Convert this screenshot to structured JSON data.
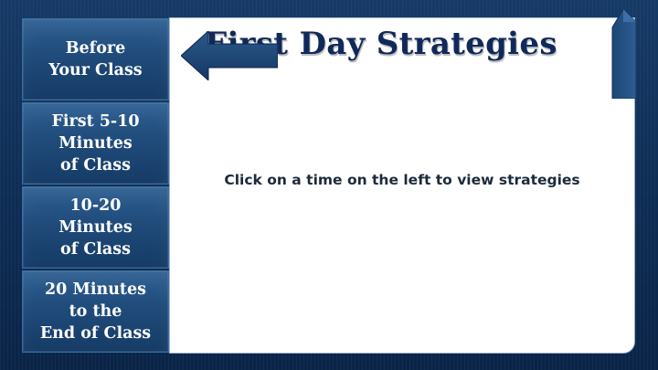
{
  "header": {
    "title": "First Day Strategies"
  },
  "sidebar": {
    "items": [
      {
        "label": "Before\nYour Class"
      },
      {
        "label": "First 5-10\nMinutes\nof Class"
      },
      {
        "label": "10-20\nMinutes\nof Class"
      },
      {
        "label": "20 Minutes\nto the\nEnd of Class"
      }
    ]
  },
  "main": {
    "instruction": "Click on a time on the left to view strategies"
  },
  "icons": {
    "back": "left-arrow-icon",
    "decor": "page-curl-icon"
  },
  "colors": {
    "background": "#0f2f57",
    "button": "#1f4a79",
    "title": "#10295a",
    "panel": "#ffffff"
  }
}
